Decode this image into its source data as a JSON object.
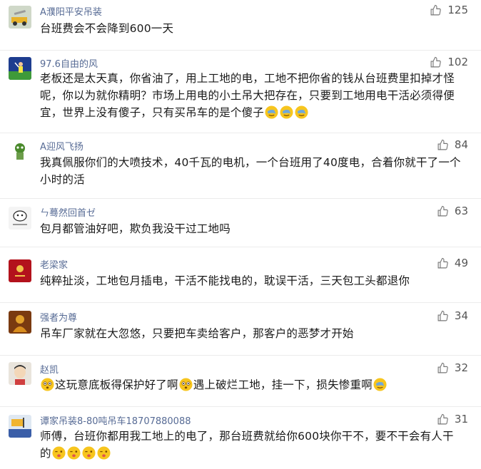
{
  "comments": [
    {
      "username": "A濮阳平安吊装",
      "likes": "125",
      "text": "台班费会不会降到600一天",
      "emojis": []
    },
    {
      "username": "97.6自由的风",
      "likes": "102",
      "text": "老板还是太天真，你省油了，用上工地的电，工地不把你省的钱从台班费里扣掉才怪呢，你以为就你精明？市场上用电的小土吊大把存在，只要到工地用电干活必须得便宜，世界上没有傻子，只有买吊车的是个傻子",
      "emojis": [
        "facepalm-emoji",
        "facepalm-emoji",
        "facepalm-emoji"
      ]
    },
    {
      "username": "A迎风飞扬",
      "likes": "84",
      "text": "我真佩服你们的大喷技术，40千瓦的电机，一个台班用了40度电，合着你就干了一个小时的活",
      "emojis": []
    },
    {
      "username": "ㄣ蓦然回首ゼ",
      "likes": "63",
      "text": "包月都管油好吧，欺负我没干过工地吗",
      "emojis": []
    },
    {
      "username": "老梁家",
      "likes": "49",
      "text": "纯粹扯淡，工地包月插电，干活不能找电的，耽误干活，三天包工头都退你",
      "emojis": []
    },
    {
      "username": "强者为尊",
      "likes": "34",
      "text": "吊车厂家就在大忽悠，只要把车卖给客户，那客户的恶梦才开始",
      "emojis": []
    },
    {
      "username": "赵凯",
      "likes": "32",
      "text_parts": [
        "这玩意底板得保护好了啊",
        "遇上破烂工地，挂一下，损失惨重啊"
      ],
      "emojis": [
        "shocked-emoji",
        "shocked-emoji",
        "facepalm-emoji"
      ]
    },
    {
      "username": "谭家吊装8-80吨吊车18707880088",
      "likes": "31",
      "text": "师傅，台班你都用我工地上的电了，那台班费就给你600块你干不，要不干会有人干的",
      "emojis": [
        "wink-emoji",
        "wink-emoji",
        "wink-emoji",
        "wink-emoji"
      ]
    }
  ],
  "colors": {
    "username": "#576b95",
    "text": "#1a1a1a",
    "like_icon": "#777777"
  }
}
